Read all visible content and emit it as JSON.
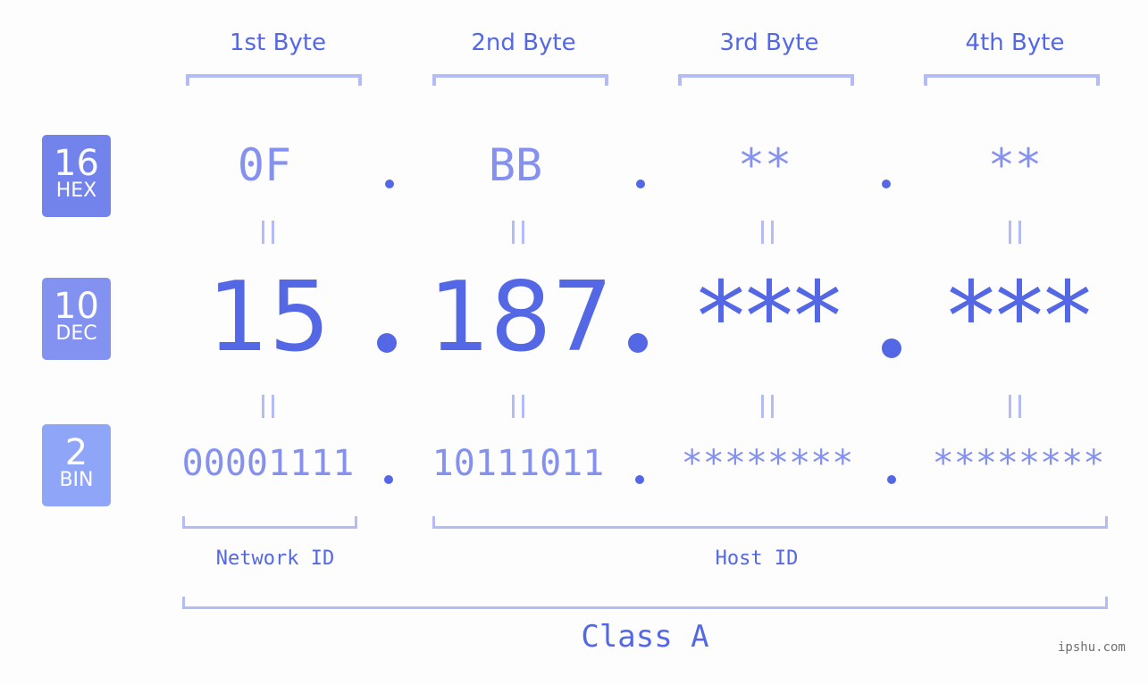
{
  "bytes": {
    "labels": [
      "1st Byte",
      "2nd Byte",
      "3rd Byte",
      "4th Byte"
    ]
  },
  "badges": {
    "hex": {
      "num": "16",
      "label": "HEX",
      "color": "#7383ec"
    },
    "dec": {
      "num": "10",
      "label": "DEC",
      "color": "#8391f0"
    },
    "bin": {
      "num": "2",
      "label": "BIN",
      "color": "#8fa6f8"
    }
  },
  "hex_values": [
    "0F",
    "BB",
    "**",
    "**"
  ],
  "dec_values": [
    "15",
    "187",
    "***",
    "***"
  ],
  "bin_values": [
    "00001111",
    "10111011",
    "********",
    "********"
  ],
  "equals_sign": "=",
  "parts": {
    "network": "Network ID",
    "host": "Host ID",
    "class": "Class A"
  },
  "watermark": "ipshu.com",
  "colors": {
    "accent": "#5468e6",
    "light": "#8591ef",
    "bracket": "#b3bcf5"
  }
}
